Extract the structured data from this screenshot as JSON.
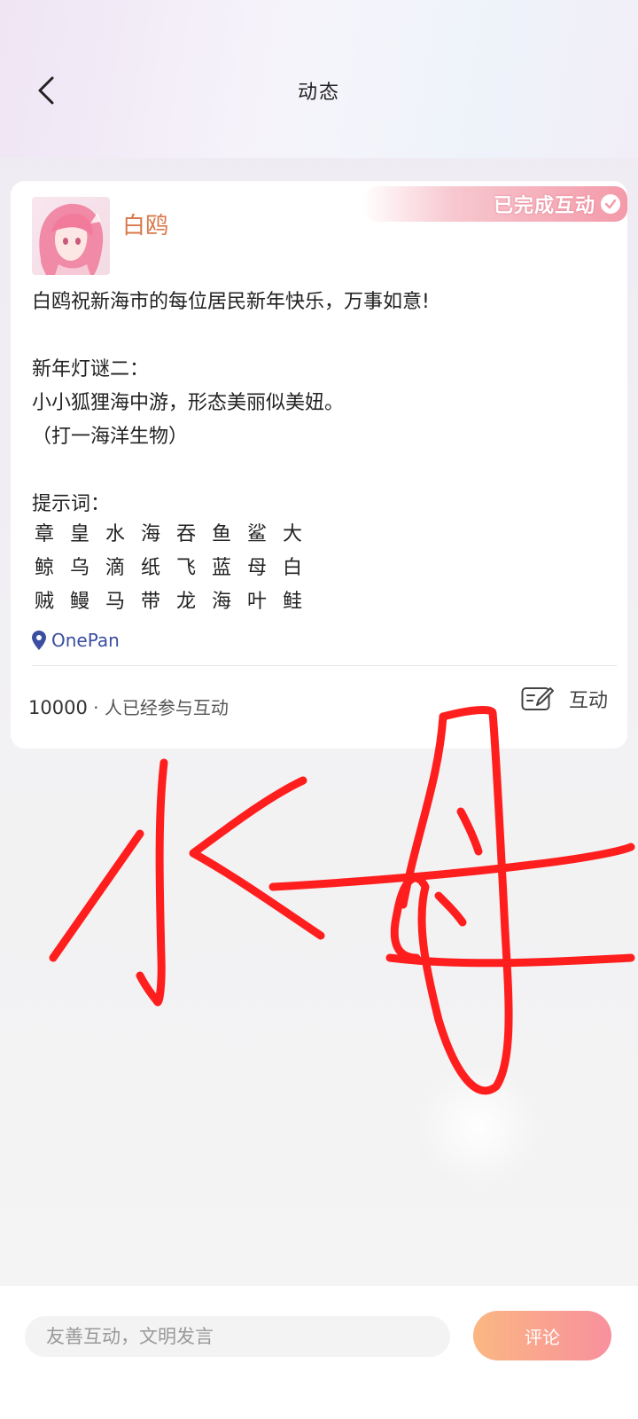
{
  "header": {
    "title": "动态"
  },
  "post": {
    "badge": "已完成互动",
    "username": "白鸥",
    "lines": [
      "白鸥祝新海市的每位居民新年快乐，万事如意!",
      "",
      "新年灯谜二：",
      "小小狐狸海中游，形态美丽似美妞。",
      "（打一海洋生物）",
      "",
      "提示词："
    ],
    "hint_rows": [
      [
        "章",
        "皇",
        "水",
        "海",
        "吞",
        "鱼",
        "鲨",
        "大"
      ],
      [
        "鲸",
        "乌",
        "滴",
        "纸",
        "飞",
        "蓝",
        "母",
        "白"
      ],
      [
        "贼",
        "鳗",
        "马",
        "带",
        "龙",
        "海",
        "叶",
        "鲑"
      ]
    ],
    "location": "OnePan",
    "participants": "10000",
    "participants_suffix": " · 人已经参与互动",
    "interact_label": "互动"
  },
  "handwriting": {
    "text": "水母",
    "color": "#ff1e1e"
  },
  "footer": {
    "input_placeholder": "友善互动，文明发言",
    "submit_label": "评论"
  },
  "colors": {
    "username": "#d9784a",
    "location": "#3b4ea0",
    "badge_gradient_end": "#f49aa9",
    "button_gradient": [
      "#fbb782",
      "#f8909d"
    ]
  }
}
